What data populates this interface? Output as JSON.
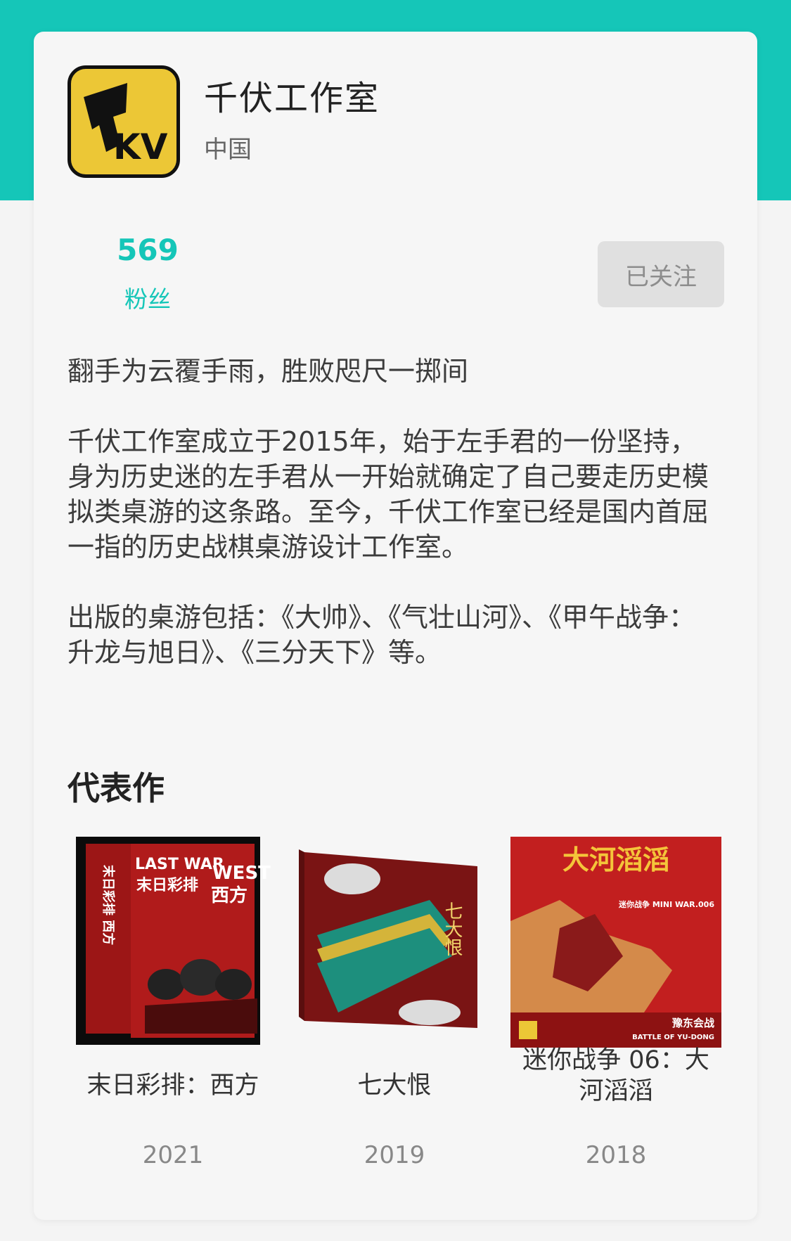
{
  "studio": {
    "name": "千伏工作室",
    "country": "中国",
    "logo_text": "KV"
  },
  "stats": {
    "fans_count": "569",
    "fans_label": "粉丝"
  },
  "follow_button": {
    "label": "已关注"
  },
  "description": {
    "slogan": "翻手为云覆手雨，胜败咫尺一掷间",
    "intro": "千伏工作室成立于2015年，始于左手君的一份坚持，身为历史迷的左手君从一开始就确定了自己要走历史模拟类桌游的这条路。至今，千伏工作室已经是国内首屈一指的历史战棋桌游设计工作室。",
    "published": "出版的桌游包括：《大帅》、《气壮山河》、《甲午战争：升龙与旭日》、《三分天下》等。"
  },
  "representative": {
    "title": "代表作",
    "works": [
      {
        "title": "末日彩排：西方",
        "year": "2021",
        "cover": {
          "icon": "last-war-west-box-icon",
          "text_en1": "LAST WAR",
          "text_en2": "WEST",
          "text_cn1": "末日彩排",
          "text_cn2": "西方",
          "text_side": "末日彩排 西方"
        }
      },
      {
        "title": "七大恨",
        "year": "2019",
        "cover": {
          "icon": "seven-grievances-box-icon",
          "text": "七大恨"
        }
      },
      {
        "title": "迷你战争 06：大河滔滔",
        "year": "2018",
        "cover": {
          "icon": "great-river-box-icon",
          "text_title": "大河滔滔",
          "text_series": "迷你战争 MINI WAR.006",
          "text_battle": "豫东会战",
          "text_battle_en": "BATTLE OF YU-DONG"
        }
      }
    ]
  },
  "colors": {
    "accent": "#15c6b8",
    "logo_yellow": "#ecc736",
    "button_bg": "#e0e0e0",
    "cover_red": "#b01b1b"
  }
}
